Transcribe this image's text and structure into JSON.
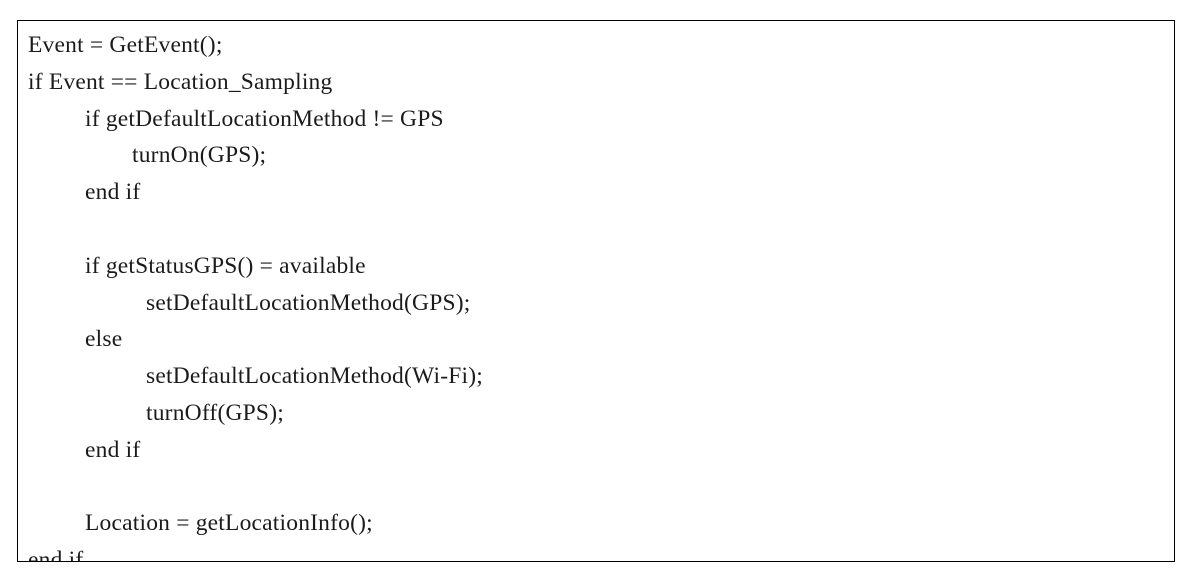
{
  "figure": {
    "kind": "pseudocode-listing",
    "border_color": "#000000",
    "text_color": "#1b1b1b",
    "background_color": "#ffffff"
  },
  "code": {
    "lines": [
      {
        "text": "Event = GetEvent();",
        "indent": 0
      },
      {
        "text": "if Event == Location_Sampling",
        "indent": 0
      },
      {
        "text": "if getDefaultLocationMethod != GPS",
        "indent": 1
      },
      {
        "text": "turnOn(GPS);",
        "indent": 2
      },
      {
        "text": "end if",
        "indent": 1
      },
      {
        "text": "",
        "indent": 0
      },
      {
        "text": "if getStatusGPS() = available",
        "indent": 1
      },
      {
        "text": "setDefaultLocationMethod(GPS);",
        "indent": 3
      },
      {
        "text": "else",
        "indent": 1
      },
      {
        "text": "setDefaultLocationMethod(Wi-Fi);",
        "indent": 3
      },
      {
        "text": "turnOff(GPS);",
        "indent": 3
      },
      {
        "text": "end if",
        "indent": 1
      },
      {
        "text": "",
        "indent": 0
      },
      {
        "text": "Location = getLocationInfo();",
        "indent": 1
      },
      {
        "text": "end if",
        "indent": 0
      }
    ]
  }
}
